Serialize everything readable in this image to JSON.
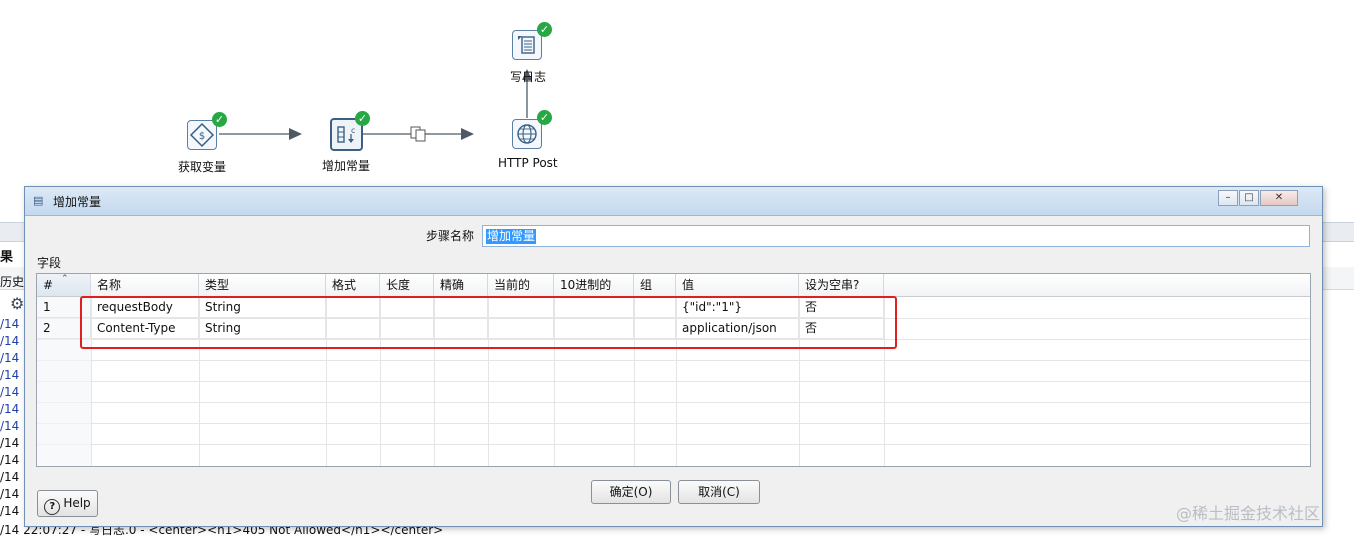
{
  "canvas": {
    "steps": [
      {
        "id": "get-vars",
        "label": "获取变量"
      },
      {
        "id": "add-const",
        "label": "增加常量"
      },
      {
        "id": "http-post",
        "label": "HTTP Post"
      },
      {
        "id": "write-log",
        "label": "写日志"
      }
    ],
    "status_icon": "checkmark-icon"
  },
  "background": {
    "result_label": "果",
    "history_label": "历史",
    "log_prefix": "/14",
    "last_log_line": "/14 22:07:27 - 写日志.0 - <center><h1>405 Not Allowed</h1></center>"
  },
  "dialog": {
    "title": "增加常量",
    "step_name_label": "步骤名称",
    "step_name_value": "增加常量",
    "fields_label": "字段",
    "columns": [
      "#",
      "名称",
      "类型",
      "格式",
      "长度",
      "精确",
      "当前的",
      "10进制的",
      "组",
      "值",
      "设为空串?"
    ],
    "rows": [
      {
        "num": "1",
        "name": "requestBody",
        "type": "String",
        "format": "",
        "length": "",
        "precision": "",
        "currency": "",
        "decimal": "",
        "group": "",
        "value": "{\"id\":\"1\"}",
        "empty": "否"
      },
      {
        "num": "2",
        "name": "Content-Type",
        "type": "String",
        "format": "",
        "length": "",
        "precision": "",
        "currency": "",
        "decimal": "",
        "group": "",
        "value": "application/json",
        "empty": "否"
      }
    ],
    "ok_label": "确定(O)",
    "cancel_label": "取消(C)",
    "help_label": "Help",
    "highlight_color": "#e02020"
  },
  "watermark": "@稀土掘金技术社区"
}
